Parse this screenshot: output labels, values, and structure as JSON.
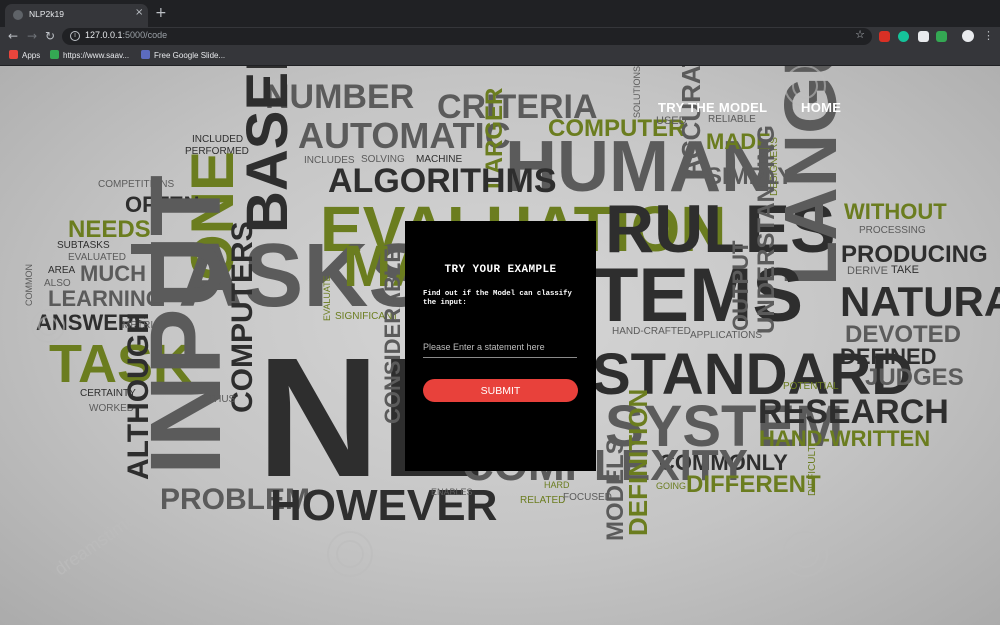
{
  "browser": {
    "tab_title": "NLP2k19",
    "tab_close": "×",
    "new_tab": "+",
    "url_host": "127.0.0.1",
    "url_rest": ":5000/code",
    "bookmarks": [
      {
        "label": "Apps",
        "icon": "apps-grid-icon",
        "color": "#e8453c"
      },
      {
        "label": "https://www.saav...",
        "icon": "saavn-icon",
        "color": "#34a853"
      },
      {
        "label": "Free Google Slide...",
        "icon": "slides-icon",
        "color": "#5c6bc0"
      }
    ],
    "extensions": [
      {
        "icon": "extension-shield-icon",
        "color": "#d93025"
      },
      {
        "icon": "grammarly-icon",
        "color": "#15c39a"
      },
      {
        "icon": "extension-page-icon",
        "color": "#e8eaed"
      },
      {
        "icon": "extension-green-icon",
        "color": "#34a853"
      }
    ]
  },
  "nav": {
    "try_model": "TRY THE MODEL",
    "home": "HOME"
  },
  "card": {
    "title": "TRY YOUR EXAMPLE",
    "description": "Find out if the Model can classify the input:",
    "input_placeholder": "Please Enter a statement here",
    "submit_label": "SUBMIT"
  },
  "word_cloud": {
    "olive": "#6b7d1f",
    "dark": "#2e2e2e",
    "mid": "#5b5b5b",
    "words": [
      "NUMBER",
      "CRITERIA",
      "SOLUTIONS",
      "AUTOMATIC",
      "COMPUTER",
      "USED",
      "ACCURATE",
      "RELIABLE",
      "INCLUDED",
      "PERFORMED",
      "INCLUDES",
      "SOLVING",
      "MACHINE",
      "LARGER",
      "HUMAN",
      "MADE",
      "SIMPLY",
      "DESIGNERS",
      "COMPETITIONS",
      "BASED",
      "ONE",
      "ALGORITHMS",
      "OFTEN",
      "EVALUATION",
      "RULES",
      "LANGUAGE",
      "WITHOUT",
      "PROCESSING",
      "NEEDS",
      "SUBTASKS",
      "TASKS",
      "PRODUCING",
      "EVALUATED",
      "MUCH",
      "AREA",
      "MA",
      "TEMS",
      "UNDERSTANDING",
      "DERIVE",
      "TAKE",
      "ALSO",
      "COMMON",
      "LEARNING",
      "EVALUATE",
      "OUTPUT",
      "NATURAL",
      "ANSWERS",
      "SIGNIFICANT",
      "METRIC",
      "HAND-CRAFTED",
      "APPLICATIONS",
      "DEVOTED",
      "TASK",
      "COMPUTERS",
      "NL",
      "CONSIDERABLE",
      "STANDARD",
      "DEFINED",
      "INPUT",
      "POTENTIAL",
      "JUDGES",
      "CERTAINTY",
      "THUS",
      "WORKED",
      "SYSTEM",
      "RESEARCH",
      "ALTHOUGH",
      "HAND-WRITTEN",
      "COMMONLY",
      "COMPLEXITY",
      "DEFINITION",
      "DIFFERENT",
      "DIFFICULT",
      "HARD",
      "GOING",
      "PROBLEM",
      "HOWEVER",
      "ENABLES",
      "RELATED",
      "FOCUSED",
      "MODELS",
      "dreamstime"
    ]
  }
}
